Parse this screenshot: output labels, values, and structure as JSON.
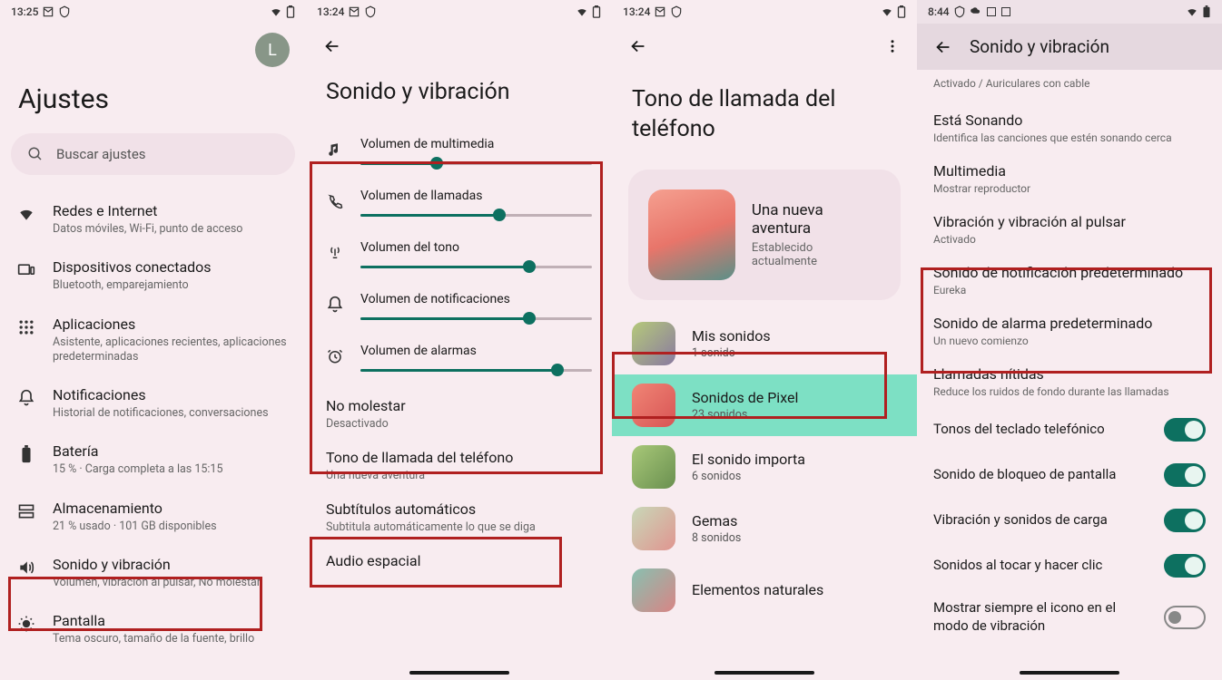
{
  "panel1": {
    "status": {
      "time": "13:25",
      "icons_left": [
        "gmail",
        "shield"
      ],
      "icons_right": [
        "wifi",
        "battery"
      ]
    },
    "avatar_letter": "L",
    "title": "Ajustes",
    "search_placeholder": "Buscar ajustes",
    "items": [
      {
        "icon": "wifi",
        "title": "Redes e Internet",
        "sub": "Datos móviles, Wi-Fi, punto de acceso"
      },
      {
        "icon": "devices",
        "title": "Dispositivos conectados",
        "sub": "Bluetooth, emparejamiento"
      },
      {
        "icon": "apps",
        "title": "Aplicaciones",
        "sub": "Asistente, aplicaciones recientes, aplicaciones predeterminadas"
      },
      {
        "icon": "bell",
        "title": "Notificaciones",
        "sub": "Historial de notificaciones, conversaciones"
      },
      {
        "icon": "battery",
        "title": "Batería",
        "sub": "15 % · Carga completa a las 15:15"
      },
      {
        "icon": "storage",
        "title": "Almacenamiento",
        "sub": "21 % usado · 101 GB disponibles"
      },
      {
        "icon": "sound",
        "title": "Sonido y vibración",
        "sub": "Volumen, vibración al pulsar, No molestar"
      },
      {
        "icon": "display",
        "title": "Pantalla",
        "sub": "Tema oscuro, tamaño de la fuente, brillo"
      }
    ]
  },
  "panel2": {
    "status": {
      "time": "13:24"
    },
    "title": "Sonido y vibración",
    "sliders": [
      {
        "icon": "music",
        "label": "Volumen de multimedia",
        "value": 33
      },
      {
        "icon": "phone",
        "label": "Volumen de llamadas",
        "value": 60
      },
      {
        "icon": "ring",
        "label": "Volumen del tono",
        "value": 73
      },
      {
        "icon": "bell",
        "label": "Volumen de notificaciones",
        "value": 73
      },
      {
        "icon": "alarm",
        "label": "Volumen de alarmas",
        "value": 85
      }
    ],
    "items": [
      {
        "title": "No molestar",
        "sub": "Desactivado"
      },
      {
        "title": "Tono de llamada del teléfono",
        "sub": "Una nueva aventura"
      },
      {
        "title": "Subtítulos automáticos",
        "sub": "Subtitula automáticamente lo que se diga"
      },
      {
        "title": "Audio espacial",
        "sub": ""
      }
    ]
  },
  "panel3": {
    "status": {
      "time": "13:24"
    },
    "title": "Tono de llamada del teléfono",
    "current": {
      "title": "Una nueva aventura",
      "sub": "Establecido actualmente"
    },
    "categories": [
      {
        "title": "Mis sonidos",
        "sub": "1 sonido",
        "gradient": "linear-gradient(135deg,#b5c97a,#8a7aa0)"
      },
      {
        "title": "Sonidos de Pixel",
        "sub": "23 sonidos",
        "gradient": "linear-gradient(135deg,#f08575,#d85555)",
        "selected": true
      },
      {
        "title": "El sonido importa",
        "sub": "6 sonidos",
        "gradient": "linear-gradient(135deg,#a8c878,#6a9050)"
      },
      {
        "title": "Gemas",
        "sub": "8 sonidos",
        "gradient": "linear-gradient(135deg,#c8d8b8,#e09590)"
      },
      {
        "title": "Elementos naturales",
        "sub": "",
        "gradient": "linear-gradient(135deg,#88c0b0,#d88585)"
      }
    ]
  },
  "panel4": {
    "status": {
      "time": "8:44"
    },
    "header_title": "Sonido y vibración",
    "top_sub": "Activado / Auriculares con cable",
    "items": [
      {
        "title": "Está Sonando",
        "sub": "Identifica las canciones que estén sonando cerca"
      },
      {
        "title": "Multimedia",
        "sub": "Mostrar reproductor"
      },
      {
        "title": "Vibración y vibración al pulsar",
        "sub": "Activado"
      },
      {
        "title": "Sonido de notificación predeterminado",
        "sub": "Eureka"
      },
      {
        "title": "Sonido de alarma predeterminado",
        "sub": "Un nuevo comienzo"
      },
      {
        "title": "Llamadas nítidas",
        "sub": "Reduce los ruidos de fondo durante las llamadas"
      }
    ],
    "toggles": [
      {
        "label": "Tonos del teclado telefónico",
        "on": true
      },
      {
        "label": "Sonido de bloqueo de pantalla",
        "on": true
      },
      {
        "label": "Vibración y sonidos de carga",
        "on": true
      },
      {
        "label": "Sonidos al tocar y hacer clic",
        "on": true
      },
      {
        "label": "Mostrar siempre el icono en el modo de vibración",
        "on": false
      }
    ]
  }
}
